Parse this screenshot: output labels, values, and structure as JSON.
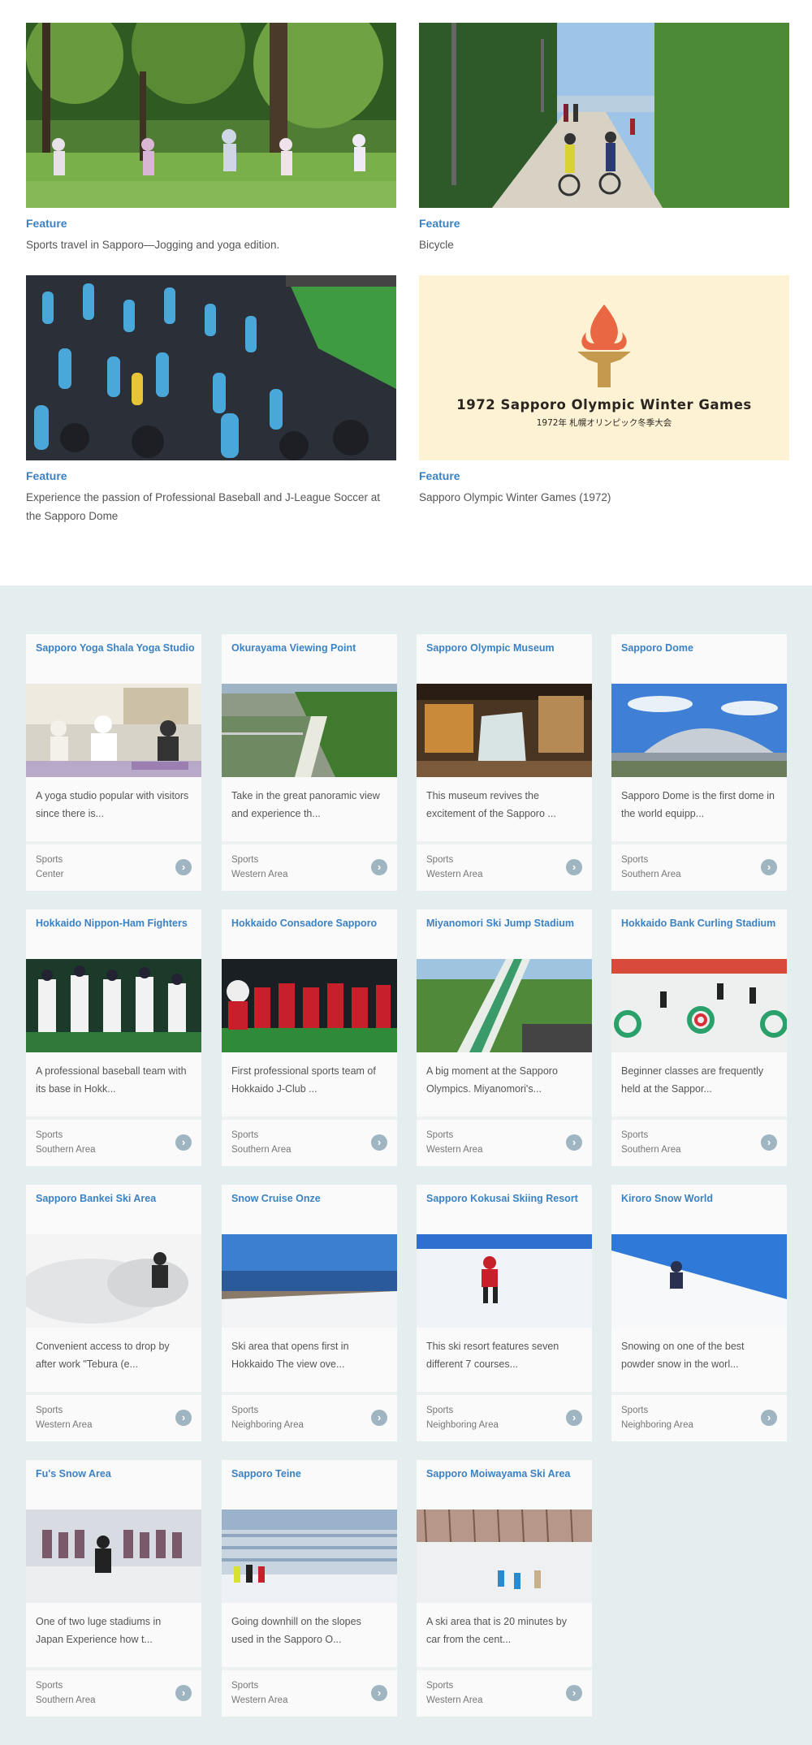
{
  "features": [
    {
      "label": "Feature",
      "text": "Sports travel in Sapporo—Jogging and yoga edition.",
      "image": "park-yoga-photo"
    },
    {
      "label": "Feature",
      "text": "Bicycle",
      "image": "cycling-path-photo"
    },
    {
      "label": "Feature",
      "text": "Experience the passion of Professional Baseball and J-League Soccer at the Sapporo Dome",
      "image": "stadium-crowd-photo"
    },
    {
      "label": "Feature",
      "text": "Sapporo Olympic Winter Games (1972)",
      "image": "olympic-torch-logo",
      "banner_title": "1972 Sapporo Olympic Winter Games",
      "banner_subtitle": "1972年 札幌オリンピック冬季大会"
    }
  ],
  "cards": [
    {
      "title": "Sapporo Yoga Shala Yoga Studio",
      "desc": "A yoga studio popular with visitors since there is...",
      "category": "Sports",
      "area": "Center",
      "image": "yoga-class"
    },
    {
      "title": "Okurayama Viewing Point",
      "desc": "Take in the great panoramic view and experience th...",
      "category": "Sports",
      "area": "Western Area",
      "image": "ski-jump-aerial"
    },
    {
      "title": "Sapporo Olympic Museum",
      "desc": "This museum revives the excitement of the Sapporo ...",
      "category": "Sports",
      "area": "Western Area",
      "image": "museum-interior"
    },
    {
      "title": "Sapporo Dome",
      "desc": "Sapporo Dome is the first dome in the world equipp...",
      "category": "Sports",
      "area": "Southern Area",
      "image": "dome-exterior"
    },
    {
      "title": "Hokkaido Nippon-Ham Fighters",
      "desc": "A professional baseball team with its base in Hokk...",
      "category": "Sports",
      "area": "Southern Area",
      "image": "baseball-team"
    },
    {
      "title": "Hokkaido Consadore Sapporo",
      "desc": "First professional sports team of Hokkaido J-Club ...",
      "category": "Sports",
      "area": "Southern Area",
      "image": "soccer-team"
    },
    {
      "title": "Miyanomori Ski Jump Stadium",
      "desc": "A big moment at the Sapporo Olympics. Miyanomori's...",
      "category": "Sports",
      "area": "Western Area",
      "image": "ski-jump-hill"
    },
    {
      "title": "Hokkaido Bank Curling Stadium",
      "desc": "Beginner classes are frequently held at the Sappor...",
      "category": "Sports",
      "area": "Southern Area",
      "image": "curling-rink"
    },
    {
      "title": "Sapporo Bankei Ski Area",
      "desc": "Convenient access to drop by after work \"Tebura (e...",
      "category": "Sports",
      "area": "Western Area",
      "image": "powder-skier"
    },
    {
      "title": "Snow Cruise Onze",
      "desc": "Ski area that opens first in Hokkaido The view ove...",
      "category": "Sports",
      "area": "Neighboring Area",
      "image": "sea-view-slope"
    },
    {
      "title": "Sapporo Kokusai Skiing Resort",
      "desc": "This ski resort features seven different 7 courses...",
      "category": "Sports",
      "area": "Neighboring Area",
      "image": "red-skier"
    },
    {
      "title": "Kiroro Snow World",
      "desc": "Snowing on one of the best powder snow in the worl...",
      "category": "Sports",
      "area": "Neighboring Area",
      "image": "blue-sky-skier"
    },
    {
      "title": "Fu's Snow Area",
      "desc": "One of two luge stadiums in Japan Experience how t...",
      "category": "Sports",
      "area": "Southern Area",
      "image": "snow-group"
    },
    {
      "title": "Sapporo Teine",
      "desc": "Going downhill on the slopes used in the Sapporo O...",
      "category": "Sports",
      "area": "Western Area",
      "image": "city-view-skiers"
    },
    {
      "title": "Sapporo Moiwayama Ski Area",
      "desc": "A ski area that is 20 minutes by car from the cent...",
      "category": "Sports",
      "area": "Western Area",
      "image": "forest-slope-skiers"
    }
  ],
  "icons": {
    "card_arrow": "chevron-right-circle-icon"
  }
}
